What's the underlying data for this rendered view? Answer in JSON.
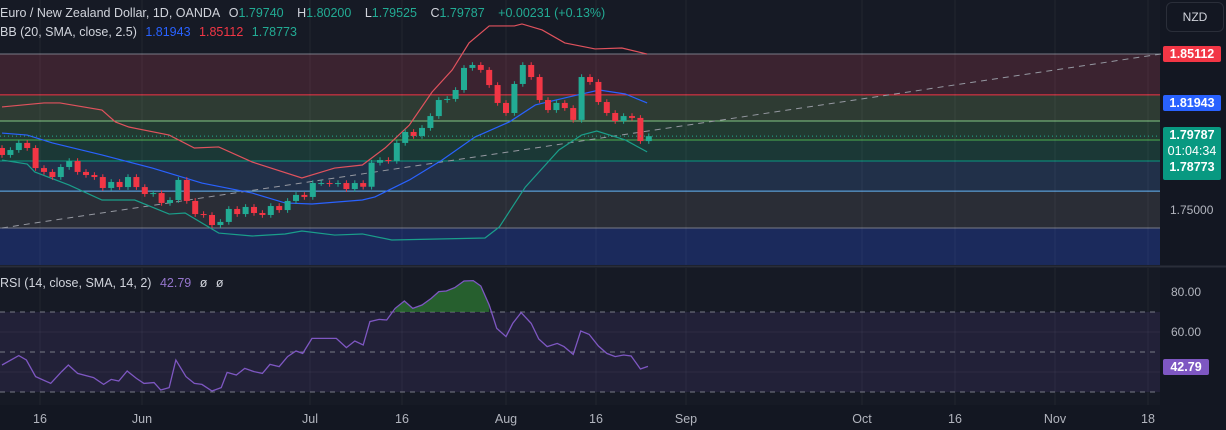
{
  "legend": {
    "symbol": "Euro / New Zealand Dollar, 1D, OANDA",
    "o_label": "O",
    "o": "1.79740",
    "h_label": "H",
    "h": "1.80200",
    "l_label": "L",
    "l": "1.79525",
    "c_label": "C",
    "c": "1.79787",
    "change": "+0.00231 (+0.13%)",
    "bb_title": "BB (20, SMA, close, 2.5)",
    "bb_basis": "1.81943",
    "bb_upper": "1.85112",
    "bb_lower": "1.78773",
    "rsi_title": "RSI (14, close, SMA, 14, 2)",
    "rsi_value": "42.79",
    "rsi_na1": "ø",
    "rsi_na2": "ø"
  },
  "price_axis": {
    "currency": "NZD",
    "upper_tag": "1.85112",
    "basis_tag": "1.81943",
    "last_price": "1.79787",
    "countdown": "01:04:34",
    "lower_tag": "1.78773",
    "tick": "1.75000"
  },
  "rsi_axis": {
    "ticks": [
      "80.00",
      "60.00"
    ],
    "value_tag": "42.79"
  },
  "time_axis": {
    "labels": [
      "16",
      "Jun",
      "Jul",
      "16",
      "Aug",
      "16",
      "Sep",
      "Oct",
      "16",
      "Nov",
      "18"
    ]
  },
  "colors": {
    "up": "#22ab94",
    "down": "#f23645",
    "upper": "#f23645",
    "basis": "#2962ff",
    "lower": "#089981",
    "rsi": "#7e57c2"
  },
  "chart_data": {
    "type": "candlestick",
    "first_open": 1.7902,
    "closes": [
      1.7857,
      1.7889,
      1.7935,
      1.7902,
      1.7772,
      1.7747,
      1.7714,
      1.7779,
      1.7818,
      1.7747,
      1.7727,
      1.7714,
      1.7643,
      1.7682,
      1.7649,
      1.7714,
      1.7649,
      1.7604,
      1.761,
      1.7546,
      1.7565,
      1.7695,
      1.7559,
      1.7474,
      1.7468,
      1.7403,
      1.7423,
      1.7507,
      1.7474,
      1.752,
      1.7481,
      1.7468,
      1.7526,
      1.75,
      1.7559,
      1.7598,
      1.7585,
      1.7675,
      1.7675,
      1.7669,
      1.7675,
      1.7636,
      1.7675,
      1.7651,
      1.7807,
      1.7824,
      1.7818,
      1.7935,
      1.8006,
      1.798,
      1.8032,
      1.8109,
      1.8213,
      1.822,
      1.8278,
      1.8421,
      1.844,
      1.8408,
      1.831,
      1.8194,
      1.8129,
      1.8317,
      1.844,
      1.8362,
      1.8213,
      1.8148,
      1.8194,
      1.8161,
      1.8084,
      1.8362,
      1.833,
      1.82,
      1.8129,
      1.8077,
      1.8109,
      1.8097,
      1.7947,
      1.79787
    ],
    "bb_upper": [
      [
        0,
        1.8168
      ],
      [
        5,
        1.8194
      ],
      [
        6.9,
        1.8194
      ],
      [
        11.9,
        1.8148
      ],
      [
        13.5,
        1.8071
      ],
      [
        15.1,
        1.8038
      ],
      [
        19.9,
        1.7986
      ],
      [
        22.9,
        1.7902
      ],
      [
        25.8,
        1.7909
      ],
      [
        29.8,
        1.7811
      ],
      [
        35.7,
        1.7708
      ],
      [
        39.6,
        1.7772
      ],
      [
        42.9,
        1.7792
      ],
      [
        45.6,
        1.7902
      ],
      [
        48.5,
        1.8051
      ],
      [
        51.2,
        1.8265
      ],
      [
        53.6,
        1.8408
      ],
      [
        55.6,
        1.8583
      ],
      [
        58,
        1.8693
      ],
      [
        61,
        1.8693
      ],
      [
        61.9,
        1.8706
      ],
      [
        64.3,
        1.8667
      ],
      [
        67,
        1.8583
      ],
      [
        70.6,
        1.8544
      ],
      [
        73.8,
        1.855
      ],
      [
        76.8,
        1.8511
      ]
    ],
    "bb_basis": [
      [
        0,
        1.7999
      ],
      [
        3,
        1.7986
      ],
      [
        6,
        1.7935
      ],
      [
        11.9,
        1.7857
      ],
      [
        17.9,
        1.7772
      ],
      [
        23.8,
        1.7675
      ],
      [
        29.8,
        1.761
      ],
      [
        33.7,
        1.7546
      ],
      [
        36.9,
        1.7539
      ],
      [
        42.9,
        1.7565
      ],
      [
        44.4,
        1.7585
      ],
      [
        48.5,
        1.7695
      ],
      [
        52.4,
        1.7824
      ],
      [
        56.3,
        1.7973
      ],
      [
        60.4,
        1.8071
      ],
      [
        63.5,
        1.8181
      ],
      [
        67.5,
        1.8233
      ],
      [
        71.1,
        1.8278
      ],
      [
        74.2,
        1.8252
      ],
      [
        76.8,
        1.8194
      ]
    ],
    "bb_lower": [
      [
        0,
        1.7824
      ],
      [
        3,
        1.7798
      ],
      [
        3.9,
        1.7747
      ],
      [
        8,
        1.7662
      ],
      [
        11.9,
        1.7565
      ],
      [
        15.8,
        1.7565
      ],
      [
        19.9,
        1.7474
      ],
      [
        21.8,
        1.7481
      ],
      [
        25.8,
        1.7351
      ],
      [
        29.8,
        1.7332
      ],
      [
        33.7,
        1.7345
      ],
      [
        35.7,
        1.7364
      ],
      [
        39.6,
        1.7338
      ],
      [
        42.9,
        1.7345
      ],
      [
        46.4,
        1.7306
      ],
      [
        57.5,
        1.7319
      ],
      [
        59.2,
        1.739
      ],
      [
        62.3,
        1.7649
      ],
      [
        66.3,
        1.7889
      ],
      [
        69,
        1.7986
      ],
      [
        70.8,
        1.8012
      ],
      [
        74.2,
        1.7954
      ],
      [
        76.8,
        1.7877
      ]
    ],
    "fib_levels": [
      1.85112,
      1.8246,
      1.8077,
      1.7954,
      1.7818,
      1.7623,
      1.7384,
      1.7144
    ],
    "trendline": [
      [
        0,
        1.7384
      ],
      [
        138,
        1.85112
      ]
    ],
    "rsi": [
      [
        0,
        43.5
      ],
      [
        2,
        48.2
      ],
      [
        2.9,
        46
      ],
      [
        4,
        37.7
      ],
      [
        5.8,
        34.3
      ],
      [
        7.1,
        40.2
      ],
      [
        7.9,
        43.5
      ],
      [
        9,
        39.3
      ],
      [
        10.9,
        37.2
      ],
      [
        12.1,
        33.8
      ],
      [
        13,
        36.3
      ],
      [
        13.9,
        35.5
      ],
      [
        14.9,
        40.5
      ],
      [
        16,
        36.8
      ],
      [
        16.9,
        34.3
      ],
      [
        18.1,
        34.7
      ],
      [
        18.9,
        31
      ],
      [
        19.9,
        32.2
      ],
      [
        20.7,
        46
      ],
      [
        21.9,
        37.7
      ],
      [
        22.9,
        34.3
      ],
      [
        23.8,
        33.8
      ],
      [
        25,
        30.5
      ],
      [
        26.1,
        32.2
      ],
      [
        26.8,
        39.8
      ],
      [
        27.9,
        38.5
      ],
      [
        28.9,
        41.8
      ],
      [
        30,
        40.2
      ],
      [
        31,
        39.3
      ],
      [
        31.9,
        43.8
      ],
      [
        33,
        42.7
      ],
      [
        34,
        47.7
      ],
      [
        35,
        50.5
      ],
      [
        35.8,
        49.3
      ],
      [
        36.9,
        56.8
      ],
      [
        39.8,
        56.8
      ],
      [
        41,
        52.2
      ],
      [
        42,
        55.5
      ],
      [
        43,
        53.5
      ],
      [
        43.8,
        65.2
      ],
      [
        44.9,
        66.3
      ],
      [
        45.8,
        66
      ],
      [
        46.8,
        71.8
      ],
      [
        47.9,
        75.5
      ],
      [
        48.9,
        71.8
      ],
      [
        50,
        73.5
      ],
      [
        51.1,
        76.8
      ],
      [
        52,
        80.2
      ],
      [
        52.9,
        80.5
      ],
      [
        53.9,
        82.2
      ],
      [
        55,
        85.5
      ],
      [
        56.1,
        85.7
      ],
      [
        57,
        83
      ],
      [
        58,
        73.5
      ],
      [
        58.9,
        61.8
      ],
      [
        60,
        57.7
      ],
      [
        60.8,
        64.3
      ],
      [
        61.8,
        69.7
      ],
      [
        63,
        64.3
      ],
      [
        63.9,
        56.5
      ],
      [
        64.9,
        52.7
      ],
      [
        66.1,
        54.3
      ],
      [
        66.9,
        52.7
      ],
      [
        68,
        48.8
      ],
      [
        68.9,
        60.5
      ],
      [
        69.9,
        58.8
      ],
      [
        71,
        53
      ],
      [
        72,
        49.3
      ],
      [
        73,
        47.7
      ],
      [
        74,
        48.5
      ],
      [
        74.9,
        48
      ],
      [
        76,
        41.5
      ],
      [
        76.9,
        42.79
      ]
    ],
    "rsi_bands": [
      70,
      50,
      30
    ]
  }
}
